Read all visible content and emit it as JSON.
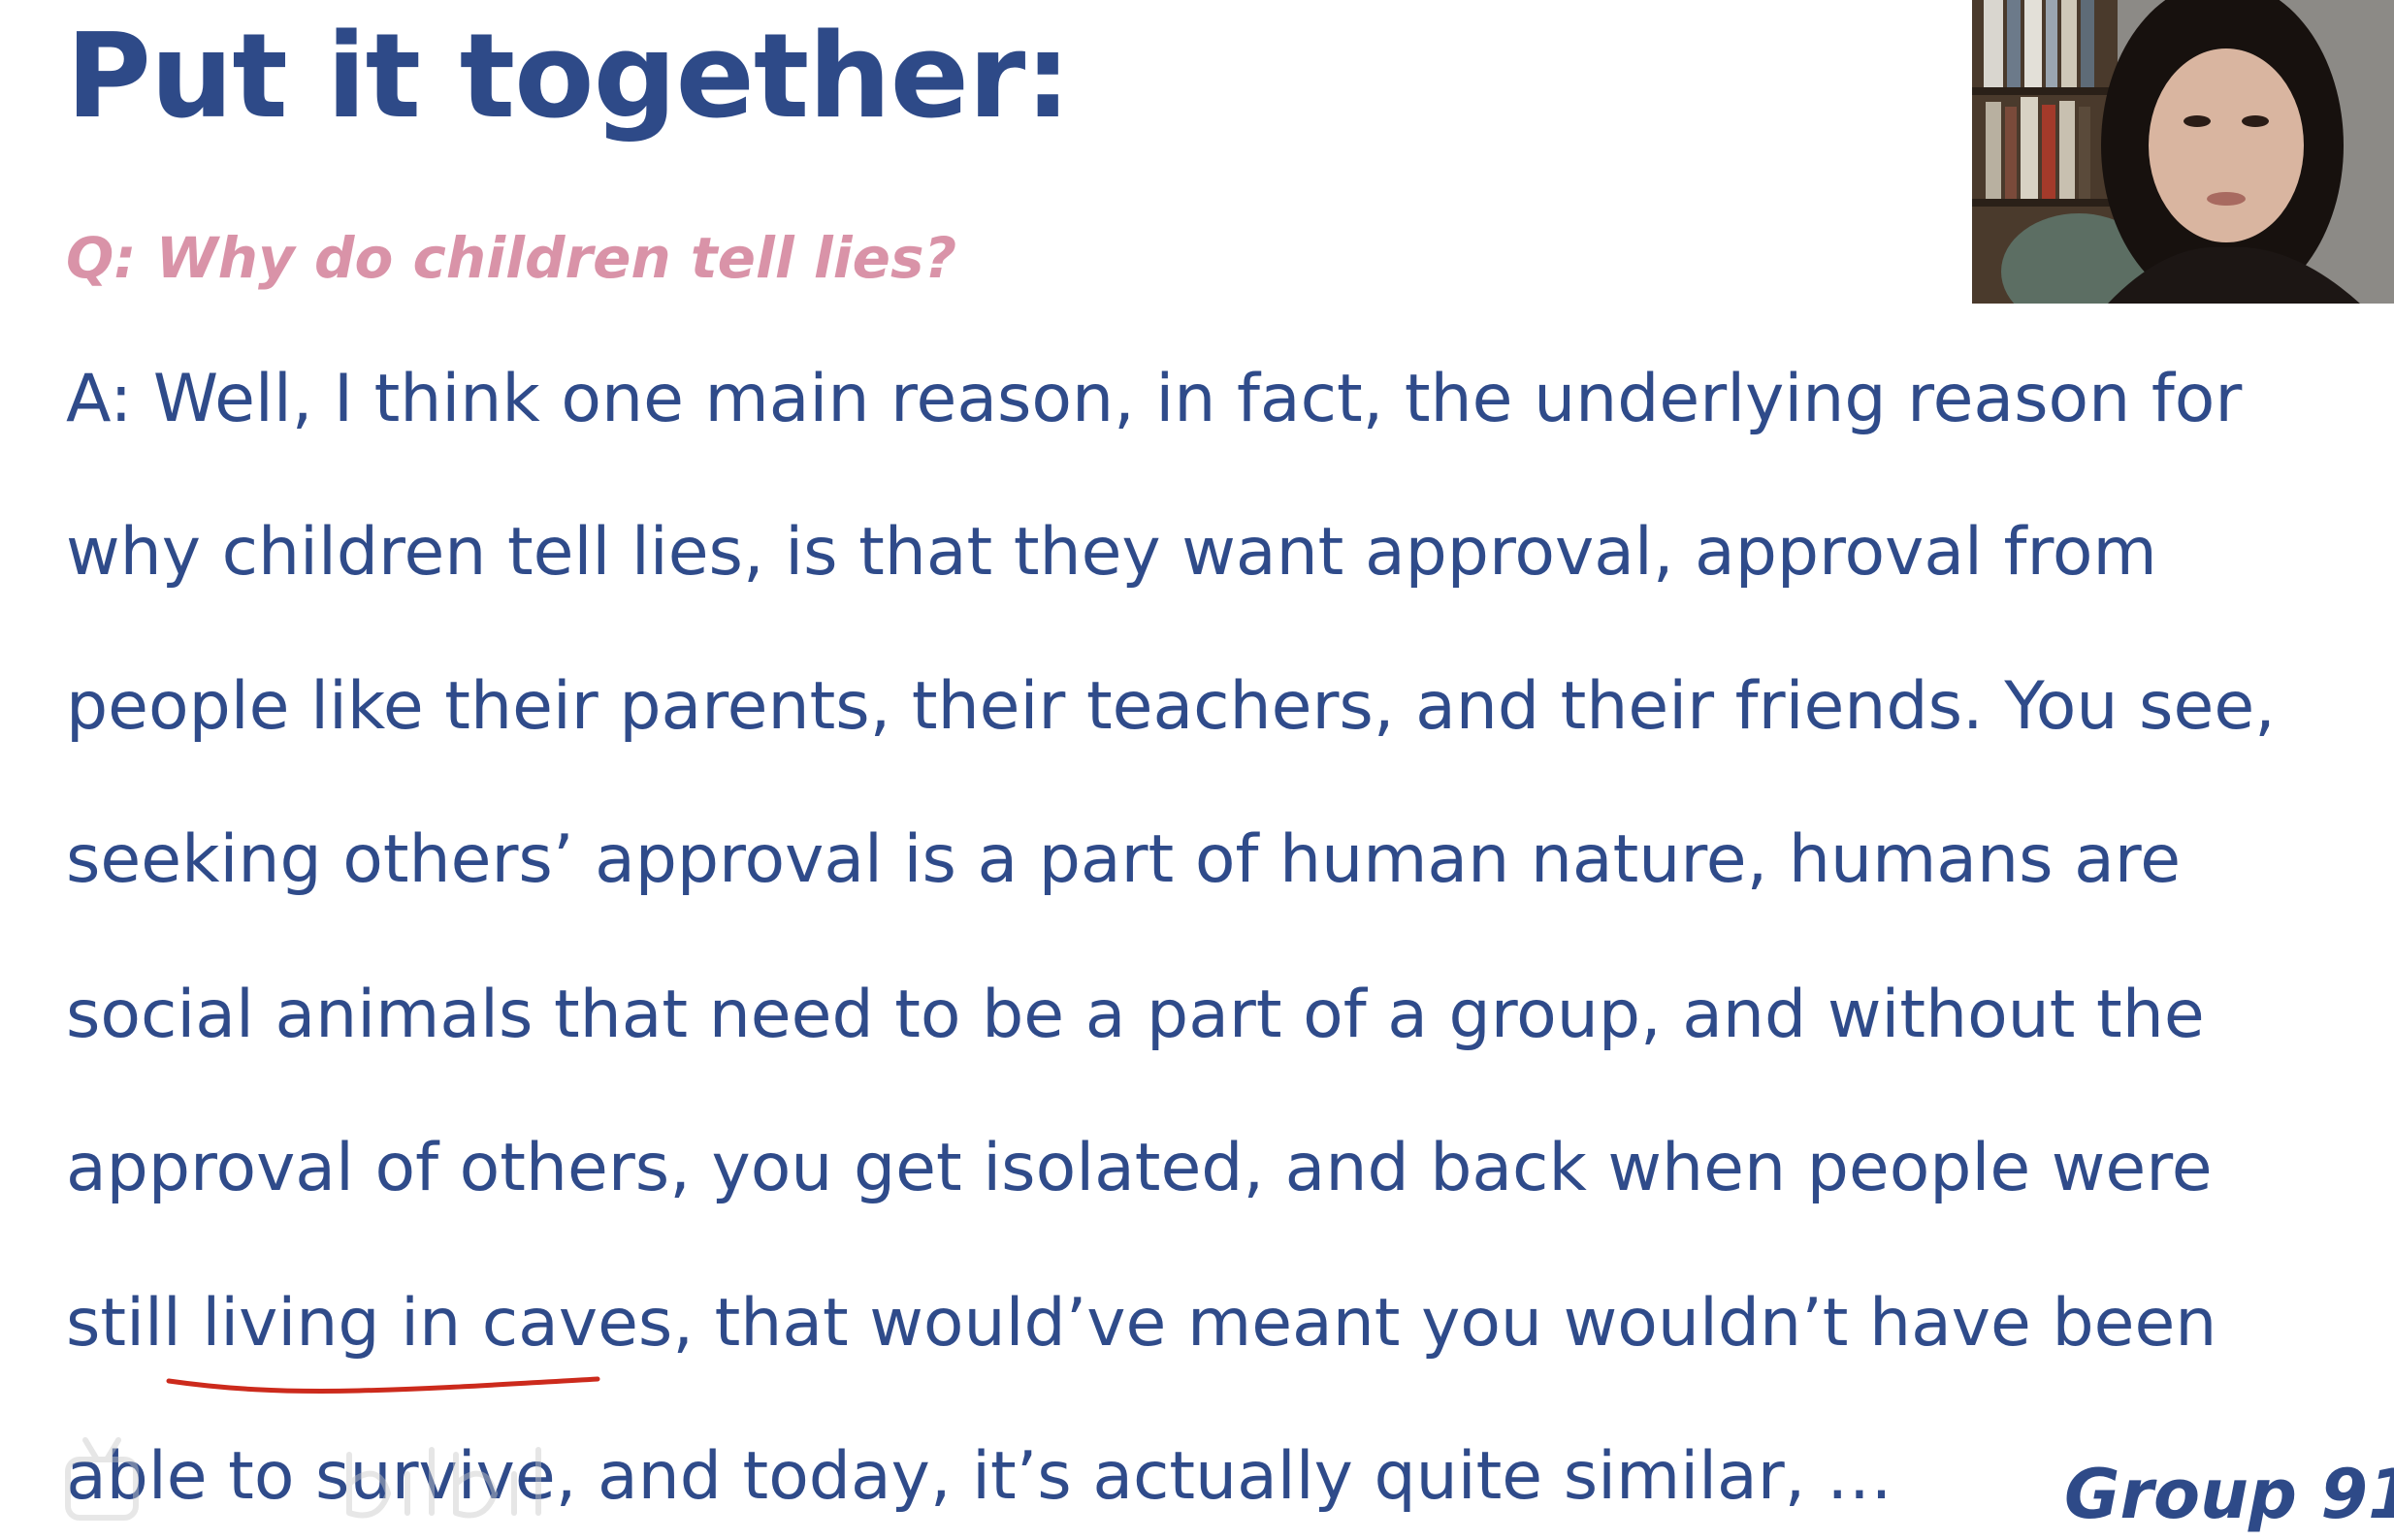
{
  "slide": {
    "title": "Put it together:",
    "question": "Q: Why do children tell lies?",
    "answer_lines": [
      "A: Well, I think one main reason, in fact, the underlying reason for",
      "why children tell lies, is that they want approval, approval from",
      "people like their parents, their teachers, and their friends. You see,",
      "seeking others’ approval is a part of human nature, humans are",
      "social animals that need to be a part of a group, and without the",
      "approval of others, you get isolated, and back when people were",
      "still living in caves, that would’ve meant you wouldn’t have been",
      "able to survive, and today, it’s actually quite similar, …"
    ],
    "underlined_phrase": "living in caves",
    "group_label": "Group 91"
  },
  "colors": {
    "title": "#2e4a88",
    "question": "#d993a8",
    "body": "#2f4b8a",
    "annotation": "#cc2a1c"
  },
  "overlays": {
    "webcam": "webcam-feed",
    "watermark_icon": "bilibili-watermark-icon"
  }
}
